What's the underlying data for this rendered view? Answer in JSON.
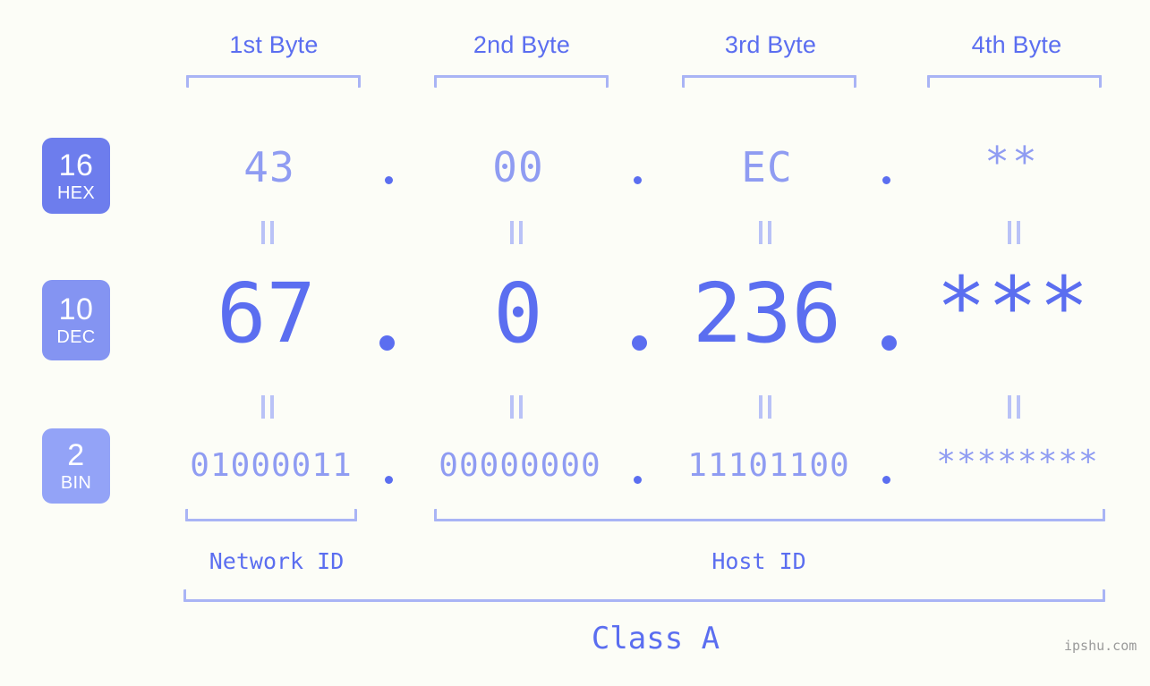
{
  "meta": {
    "background_color": "#fcfdf7",
    "accent_dark": "#5b6ef0",
    "accent_light": "#8f9cf2",
    "bracket_color": "#a9b4f5",
    "badge_hex_color": "#6d7ded",
    "badge_dec_color": "#8494f2",
    "badge_bin_color": "#93a3f7"
  },
  "headers": [
    {
      "label": "1st Byte"
    },
    {
      "label": "2nd Byte"
    },
    {
      "label": "3rd Byte"
    },
    {
      "label": "4th Byte"
    }
  ],
  "radix_badges": [
    {
      "number": "16",
      "label": "HEX"
    },
    {
      "number": "10",
      "label": "DEC"
    },
    {
      "number": "2",
      "label": "BIN"
    }
  ],
  "rows": {
    "hex": {
      "values": [
        "43",
        "00",
        "EC",
        "**"
      ],
      "separator": "."
    },
    "dec": {
      "values": [
        "67",
        "0",
        "236",
        "***"
      ],
      "separator": "."
    },
    "bin": {
      "values": [
        "01000011",
        "00000000",
        "11101100",
        "********"
      ],
      "separator": "."
    }
  },
  "equality_marks": {
    "symbol": "||",
    "count_per_row": 4,
    "rows": 2
  },
  "segments": [
    {
      "name": "Network ID",
      "label": "Network ID"
    },
    {
      "name": "Host ID",
      "label": "Host ID"
    }
  ],
  "class_info": {
    "label": "Class A"
  },
  "watermark": {
    "text": "ipshu.com"
  }
}
